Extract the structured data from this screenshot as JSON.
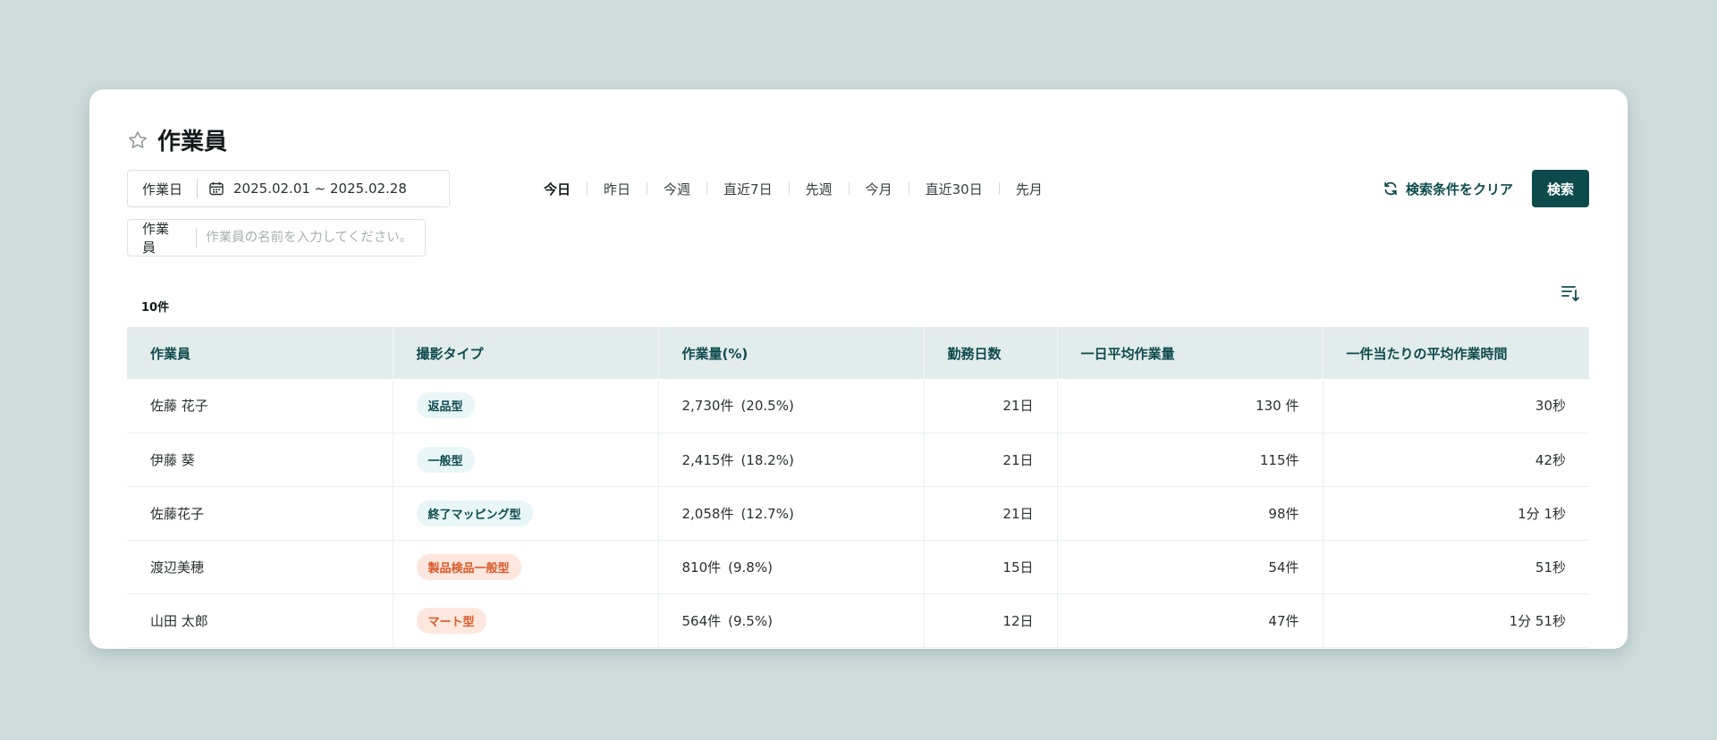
{
  "page": {
    "title": "作業員"
  },
  "filters": {
    "date_label": "作業日",
    "date_range": "2025.02.01 ~ 2025.02.28",
    "worker_label": "作業員",
    "worker_placeholder": "作業員の名前を入力してください。",
    "quick_ranges": [
      "今日",
      "昨日",
      "今週",
      "直近7日",
      "先週",
      "今月",
      "直近30日",
      "先月"
    ],
    "active_range": "今日"
  },
  "actions": {
    "clear_label": "検索条件をクリア",
    "search_label": "検索"
  },
  "results": {
    "count_label": "10件"
  },
  "table": {
    "headers": [
      "作業員",
      "撮影タイプ",
      "作業量(%)",
      "勤務日数",
      "一日平均作業量",
      "一件当たりの平均作業時間"
    ],
    "rows": [
      {
        "name": "佐藤 花子",
        "type": "返品型",
        "type_color": "teal",
        "volume": "2,730件",
        "pct": "(20.5%)",
        "days": "21日",
        "avg": "130 件",
        "time": "30秒"
      },
      {
        "name": "伊藤 葵",
        "type": "一般型",
        "type_color": "teal",
        "volume": "2,415件",
        "pct": "(18.2%)",
        "days": "21日",
        "avg": "115件",
        "time": "42秒"
      },
      {
        "name": "佐藤花子",
        "type": "終了マッピング型",
        "type_color": "teal",
        "volume": "2,058件",
        "pct": "(12.7%)",
        "days": "21日",
        "avg": "98件",
        "time": "1分 1秒"
      },
      {
        "name": "渡辺美穂",
        "type": "製品検品一般型",
        "type_color": "orange",
        "volume": "810件",
        "pct": "(9.8%)",
        "days": "15日",
        "avg": "54件",
        "time": "51秒"
      },
      {
        "name": "山田 太郎",
        "type": "マート型",
        "type_color": "orange",
        "volume": "564件",
        "pct": "(9.5%)",
        "days": "12日",
        "avg": "47件",
        "time": "1分 51秒"
      }
    ]
  },
  "colors": {
    "brand": "#0d4a4c",
    "tag_teal_bg": "#e9f6f8",
    "tag_orange_bg": "#fde6dd",
    "tag_orange_text": "#d75a2a"
  },
  "icons": {
    "title": "star-outline-icon",
    "date": "calendar-icon",
    "clear": "refresh-icon",
    "sort": "sort-descending-icon"
  }
}
